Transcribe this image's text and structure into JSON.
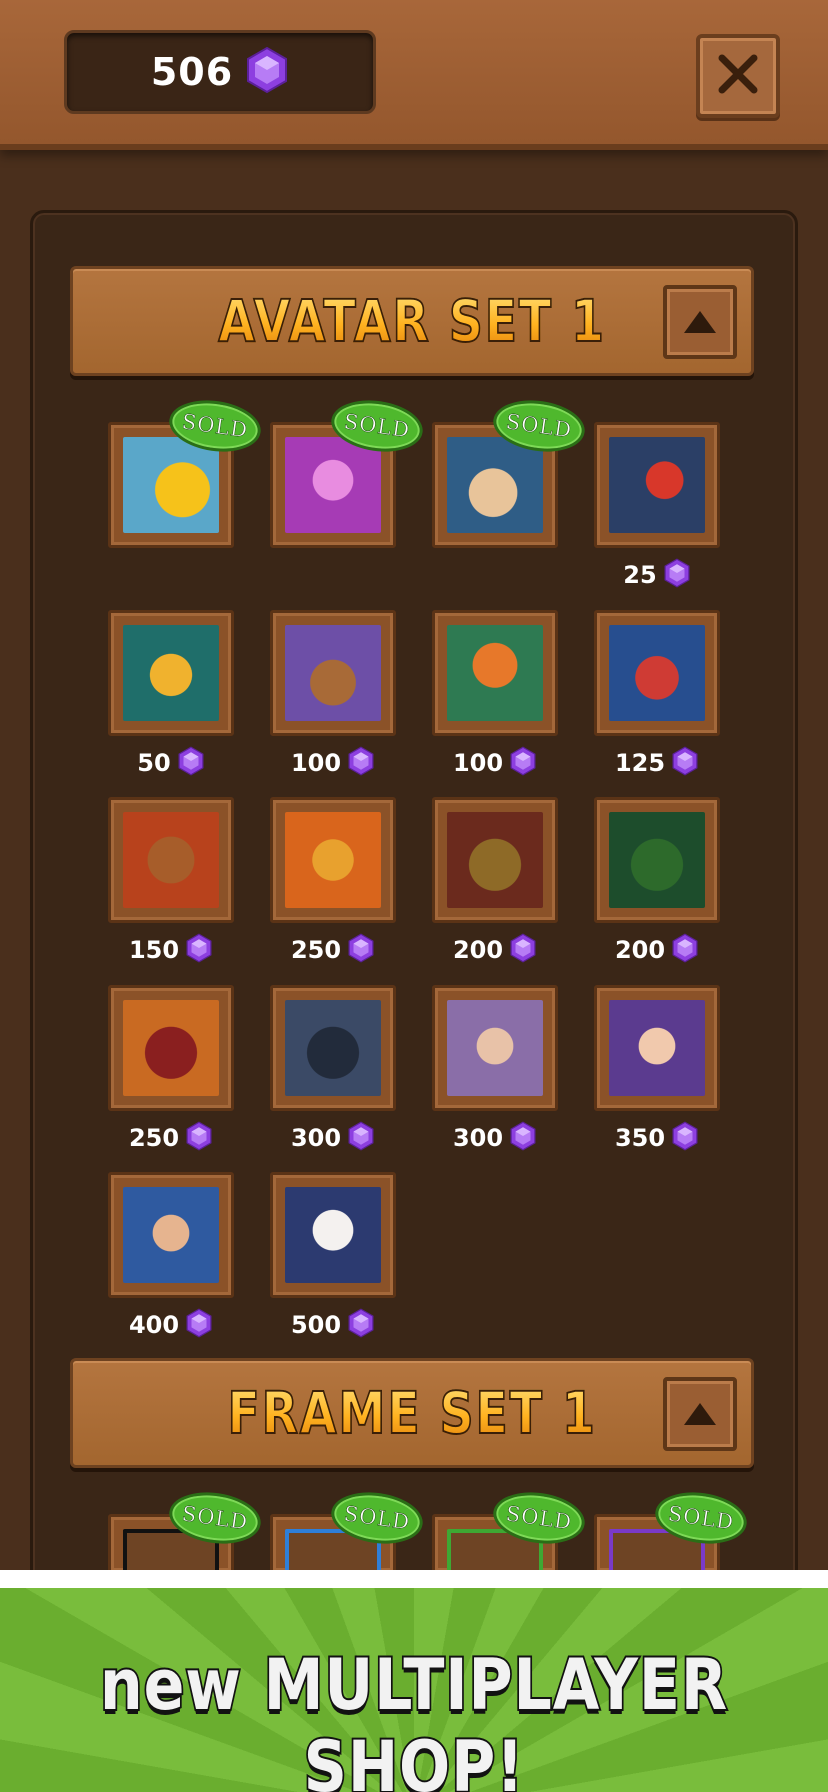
{
  "header": {
    "gem_count": "506",
    "close_icon": "close-x-icon"
  },
  "currency_icon": "purple-gem-icon",
  "sections": {
    "avatars": {
      "title": "AVATAR SET 1",
      "toggle_icon": "triangle-up-icon",
      "items": [
        {
          "name": "duck",
          "sold_label": "SOLD",
          "price": ""
        },
        {
          "name": "pixel-robot",
          "sold_label": "SOLD",
          "price": ""
        },
        {
          "name": "nautilus",
          "sold_label": "SOLD",
          "price": ""
        },
        {
          "name": "red-crab",
          "sold_label": "",
          "price": "25"
        },
        {
          "name": "starfish",
          "sold_label": "",
          "price": "50"
        },
        {
          "name": "dinosaur",
          "sold_label": "",
          "price": "100"
        },
        {
          "name": "pumpkin",
          "sold_label": "",
          "price": "100"
        },
        {
          "name": "diver-robot",
          "sold_label": "",
          "price": "125"
        },
        {
          "name": "tiki-mask",
          "sold_label": "",
          "price": "150"
        },
        {
          "name": "dragon",
          "sold_label": "",
          "price": "250"
        },
        {
          "name": "ninja-yellow",
          "sold_label": "",
          "price": "200"
        },
        {
          "name": "ninja-green",
          "sold_label": "",
          "price": "200"
        },
        {
          "name": "ninja-red",
          "sold_label": "",
          "price": "250"
        },
        {
          "name": "ninja-black",
          "sold_label": "",
          "price": "300"
        },
        {
          "name": "geisha",
          "sold_label": "",
          "price": "300"
        },
        {
          "name": "blue-hair-ninja",
          "sold_label": "",
          "price": "350"
        },
        {
          "name": "green-hair-fighter",
          "sold_label": "",
          "price": "400"
        },
        {
          "name": "fox-mask",
          "sold_label": "",
          "price": "500"
        }
      ]
    },
    "frames": {
      "title": "FRAME SET 1",
      "toggle_icon": "triangle-up-icon",
      "items": [
        {
          "name": "frame-black",
          "sold_label": "SOLD"
        },
        {
          "name": "frame-blue",
          "sold_label": "SOLD"
        },
        {
          "name": "frame-green",
          "sold_label": "SOLD"
        },
        {
          "name": "frame-purple",
          "sold_label": "SOLD"
        }
      ]
    }
  },
  "banner": {
    "text": "new MULTIPLAYER SHOP!"
  },
  "colors": {
    "gem": "#9b4fe0",
    "sold_badge": "#4fb82d",
    "panel": "#3a2617",
    "title_gold": "#ffb220"
  }
}
